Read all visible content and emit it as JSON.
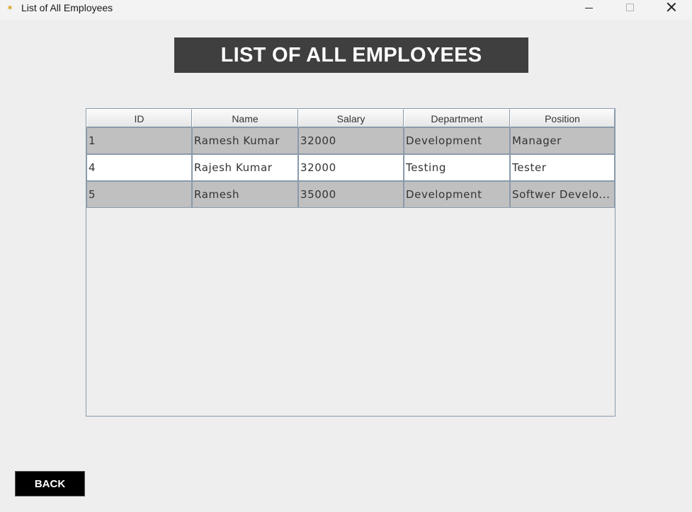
{
  "window": {
    "title": "List of All Employees",
    "icon": "java-app-icon",
    "controls": [
      "minimize",
      "maximize",
      "close"
    ]
  },
  "heading": "LIST OF ALL EMPLOYEES",
  "table": {
    "columns": [
      "ID",
      "Name",
      "Salary",
      "Department",
      "Position"
    ],
    "rows": [
      [
        "1",
        "Ramesh Kumar",
        "32000",
        "Development",
        "Manager"
      ],
      [
        "4",
        "Rajesh Kumar",
        "32000",
        "Testing",
        "Tester"
      ],
      [
        "5",
        "Ramesh",
        "35000",
        "Development",
        "Softwer Develo..."
      ]
    ]
  },
  "back_label": "BACK",
  "colors": {
    "banner_bg": "#3f3f3f",
    "row_alt_bg": "#c0c0c0",
    "back_bg": "#000000"
  }
}
